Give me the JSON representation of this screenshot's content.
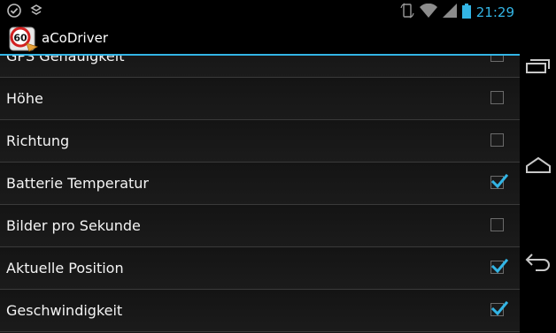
{
  "status_bar": {
    "time": "21:29",
    "left_icons": [
      "checkmark-notification-icon",
      "layers-notification-icon"
    ],
    "right_icons": [
      "rotation-icon",
      "wifi-icon",
      "signal-icon",
      "battery-icon"
    ]
  },
  "action_bar": {
    "app_icon": "speed-limit-60-icon",
    "title": "aCoDriver"
  },
  "settings": [
    {
      "label": "GPS Genauigkeit",
      "checked": false
    },
    {
      "label": "Höhe",
      "checked": false
    },
    {
      "label": "Richtung",
      "checked": false
    },
    {
      "label": "Batterie Temperatur",
      "checked": true
    },
    {
      "label": "Bilder pro Sekunde",
      "checked": false
    },
    {
      "label": "Aktuelle Position",
      "checked": true
    },
    {
      "label": "Geschwindigkeit",
      "checked": true
    }
  ],
  "nav_bar": {
    "buttons": [
      "recent-apps-icon",
      "home-icon",
      "back-icon"
    ]
  },
  "colors": {
    "accent": "#33b5e5",
    "background": "#141414",
    "divider": "#3a3a3a"
  }
}
